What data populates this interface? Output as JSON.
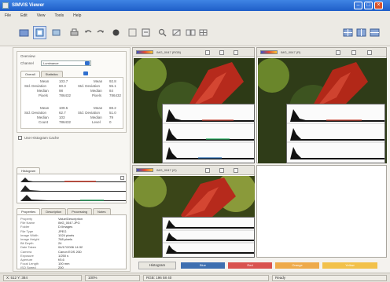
{
  "window": {
    "title": "SIMVIS Viewer",
    "controls": [
      "minimize",
      "maximize",
      "close"
    ]
  },
  "menu": [
    "File",
    "Edit",
    "View",
    "Tools",
    "Help"
  ],
  "toolbar": {
    "left_icons": [
      "open-icon",
      "pointer-icon",
      "crop-icon",
      "print-icon",
      "undo-icon",
      "redo-icon",
      "pan-icon",
      "fit-icon",
      "zoom-icon",
      "measure-icon",
      "grid-icon"
    ],
    "right_icons": [
      "layout-grid-icon",
      "layout-split-icon",
      "layout-single-icon"
    ]
  },
  "left_panel": {
    "group_title": "Overview",
    "channel_label": "Channel",
    "channel_value": "Luminance",
    "tabs": [
      "Overall",
      "Statistics"
    ],
    "stats_a": {
      "label_1": "Mean",
      "value_1": "103.7",
      "label_2": "Std. Deviation",
      "value_2": "60.3",
      "label_3": "Median",
      "value_3": "98",
      "label_4": "Pixels",
      "value_4": "786432"
    },
    "stats_b": {
      "label_1": "Mean",
      "value_1": "92.8",
      "label_2": "Std. Deviation",
      "value_2": "55.1",
      "label_3": "Median",
      "value_3": "84",
      "label_4": "Pixels",
      "value_4": "786432"
    },
    "stats_c": {
      "label_1": "Mean",
      "value_1": "109.5",
      "label_2": "Std. Deviation",
      "value_2": "62.7",
      "label_3": "Median",
      "value_3": "103",
      "label_4": "Count",
      "value_4": "786432"
    },
    "stats_d": {
      "label_1": "Mean",
      "value_1": "88.2",
      "label_2": "Std. Deviation",
      "value_2": "51.0",
      "label_3": "Median",
      "value_3": "79",
      "label_4": "Level",
      "value_4": "0"
    },
    "checkbox_label": "Use Histogram Cache",
    "histogram_tab": "Histogram",
    "lower_tabs": [
      "Properties",
      "Description",
      "Processing",
      "Notes"
    ],
    "properties": [
      {
        "k": "Property",
        "v": "Value/Description"
      },
      {
        "k": "File Name",
        "v": "IMG_0047.JPG"
      },
      {
        "k": "Folder",
        "v": "D:\\Images"
      },
      {
        "k": "File Type",
        "v": "JPEG"
      },
      {
        "k": "Image Width",
        "v": "1024 pixels"
      },
      {
        "k": "Image Height",
        "v": "768 pixels"
      },
      {
        "k": "Bit Depth",
        "v": "24"
      },
      {
        "k": "Date Taken",
        "v": "04/17/2006 14:32"
      },
      {
        "k": "Camera",
        "v": "Canon EOS 20D"
      },
      {
        "k": "Exposure",
        "v": "1/250 s"
      },
      {
        "k": "Aperture",
        "v": "f/5.6"
      },
      {
        "k": "Focal Length",
        "v": "100 mm"
      },
      {
        "k": "ISO Speed",
        "v": "200"
      }
    ]
  },
  "panes": [
    {
      "label": "IMG_0047 (RGB)",
      "buttons": [
        "pane-btn-a",
        "pane-btn-b",
        "pane-btn-c"
      ]
    },
    {
      "label": "IMG_0047 (R)",
      "buttons": [
        "pane-btn-a",
        "pane-btn-b",
        "pane-btn-c"
      ]
    },
    {
      "label": "IMG_0047 (G)",
      "buttons": [
        "pane-btn-a",
        "pane-btn-b",
        "pane-btn-c"
      ]
    }
  ],
  "bottom_tabs": [
    {
      "label": "Histogram",
      "color": "#e9e7e0"
    },
    {
      "label": "Blue",
      "color": "#3e6fb0"
    },
    {
      "label": "Red",
      "color": "#d9534f"
    },
    {
      "label": "Orange",
      "color": "#eeaa4a"
    },
    {
      "label": "Yellow",
      "color": "#f2c14b"
    }
  ],
  "status": {
    "cell_1": "X: 512  Y: 384",
    "cell_2": "100%",
    "cell_3": "RGB: 196 58 40",
    "cell_4": "Ready"
  },
  "colors": {
    "titlebar": "#2a6fd6",
    "pane_bg": "#ffffff",
    "accent_selected": "#d7e3f6"
  }
}
